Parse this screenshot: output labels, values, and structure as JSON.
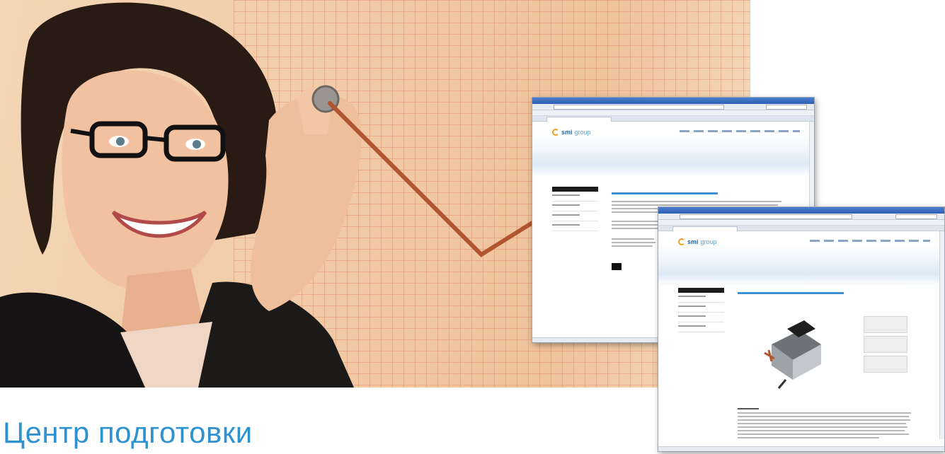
{
  "caption": {
    "title": "Центр подготовки"
  },
  "colors": {
    "caption": "#2e92d0",
    "brand_blue": "#1b6fb3",
    "brand_orange": "#f0a01e",
    "grid_line": "#d6785a",
    "trend_line": "#b0552f"
  },
  "icons": [
    "smigroup-logo-icon",
    "trend-line-icon"
  ],
  "window_back": {
    "logo_text_bold": "smi",
    "logo_text_light": "group"
  },
  "window_front": {
    "logo_text_bold": "smi",
    "logo_text_light": "group"
  }
}
